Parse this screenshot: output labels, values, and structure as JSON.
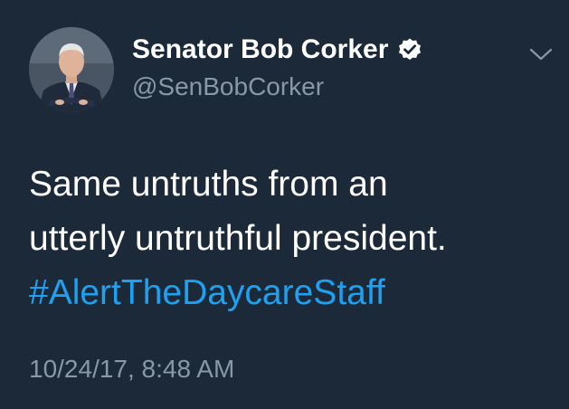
{
  "tweet": {
    "author": {
      "display_name": "Senator Bob Corker",
      "handle": "@SenBobCorker",
      "verified_icon": "verified-badge-icon",
      "avatar": "profile-photo"
    },
    "text_lines": [
      "Same untruths from an",
      "utterly untruthful president."
    ],
    "hashtag": "#AlertTheDaycareStaff",
    "timestamp": "10/24/17, 8:48 AM",
    "menu_icon": "chevron-down-icon"
  },
  "colors": {
    "background": "#1c2938",
    "text": "#ffffff",
    "secondary": "#8899a6",
    "link": "#1da1f2"
  }
}
